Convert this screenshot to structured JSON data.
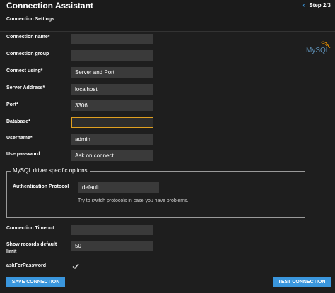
{
  "header": {
    "title": "Connection Assistant",
    "step": "Step 2/3",
    "section": "Connection Settings"
  },
  "logo": {
    "text": "MySQL"
  },
  "form": {
    "connection_name": {
      "label": "Connection name*",
      "value": ""
    },
    "connection_group": {
      "label": "Connection group",
      "value": ""
    },
    "connect_using": {
      "label": "Connect using*",
      "value": "Server and Port"
    },
    "server_address": {
      "label": "Server Address*",
      "value": "localhost"
    },
    "port": {
      "label": "Port*",
      "value": "3306"
    },
    "database": {
      "label": "Database*",
      "value": ""
    },
    "username": {
      "label": "Username*",
      "value": "admin"
    },
    "use_password": {
      "label": "Use password",
      "value": "Ask on connect"
    }
  },
  "driver_options": {
    "legend": "MySQL driver specific options",
    "auth_protocol": {
      "label": "Authentication Protocol",
      "value": "default"
    },
    "hint": "Try to switch protocols in case you have problems."
  },
  "advanced": {
    "connection_timeout": {
      "label": "Connection Timeout",
      "value": ""
    },
    "show_records": {
      "label_line1": "Show records default",
      "label_line2": "limit",
      "value": "50"
    },
    "ask_for_password": {
      "label": "askForPassword",
      "checked": true
    }
  },
  "buttons": {
    "save": "SAVE CONNECTION",
    "test": "TEST CONNECTION"
  },
  "colors": {
    "accent": "#3a96dd",
    "focus_border": "#e0a020",
    "background": "#1e1e1e",
    "field_bg": "#3a3a3a"
  },
  "icons": {
    "step_arrow": "chevron-left-icon",
    "check": "check-icon",
    "logo": "mysql-dolphin-icon"
  }
}
